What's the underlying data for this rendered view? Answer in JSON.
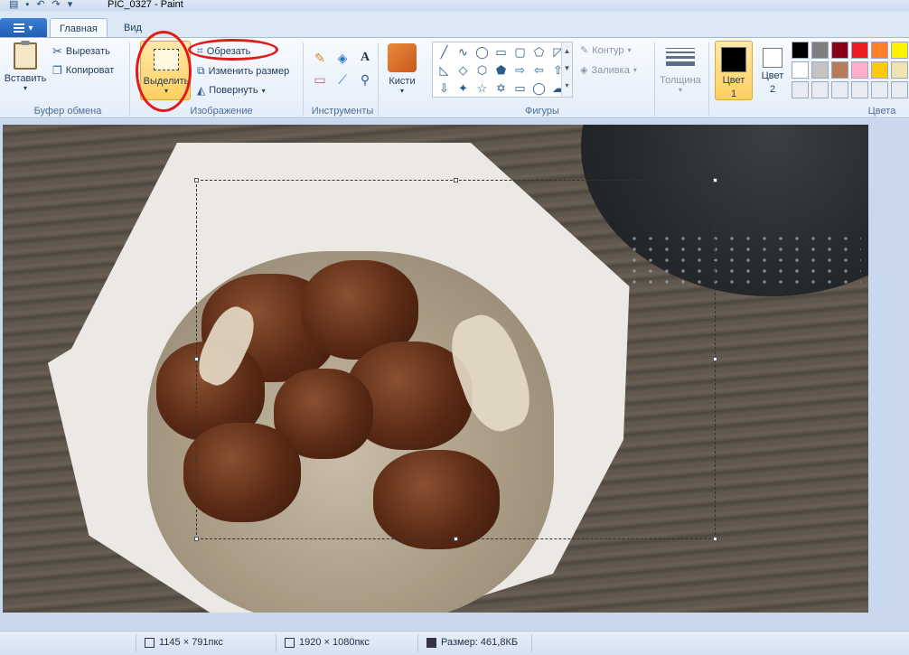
{
  "window": {
    "title": "PIC_0327 - Paint"
  },
  "quick_access": [
    "save-icon",
    "undo-icon",
    "redo-icon",
    "dropdown-icon"
  ],
  "tabs": [
    {
      "label": "Главная",
      "active": true
    },
    {
      "label": "Вид",
      "active": false
    }
  ],
  "clipboard": {
    "paste": "Вставить",
    "cut": "Вырезать",
    "copy": "Копироват",
    "group": "Буфер обмена"
  },
  "image": {
    "select": "Выделить",
    "crop": "Обрезать",
    "resize": "Изменить размер",
    "rotate": "Повернуть",
    "group": "Изображение"
  },
  "tools": {
    "group": "Инструменты",
    "items": [
      "pencil-icon",
      "fill-icon",
      "text-icon",
      "eraser-icon",
      "color-picker-icon",
      "magnifier-icon"
    ]
  },
  "brushes": {
    "label": "Кисти"
  },
  "shapes": {
    "group": "Фигуры",
    "outline": "Контур",
    "fill": "Заливка",
    "glyphs": [
      "╱",
      "∿",
      "◯",
      "▭",
      "▢",
      "⬠",
      "◸",
      "◺",
      "◇",
      "⬡",
      "⬟",
      "⇨",
      "⇦",
      "⇧",
      "⇩",
      "✦",
      "☆",
      "✡",
      "▭",
      "◯",
      "☁"
    ]
  },
  "thickness": {
    "label": "Толщина"
  },
  "colors": {
    "group": "Цвета",
    "color1": {
      "label_line1": "Цвет",
      "label_line2": "1",
      "value": "#000000"
    },
    "color2": {
      "label_line1": "Цвет",
      "label_line2": "2",
      "value": "#ffffff"
    },
    "palette": [
      "#000000",
      "#7f7f7f",
      "#880015",
      "#ed1c24",
      "#ff7f27",
      "#fff200",
      "#ffffff",
      "#c3c3c3",
      "#b97a57",
      "#ffaec9",
      "#ffc90e",
      "#efe4b0",
      "#e8ecf2",
      "#e8ecf2",
      "#e8ecf2",
      "#e8ecf2",
      "#e8ecf2",
      "#e8ecf2"
    ]
  },
  "status": {
    "selection_size": "1145 × 791пкс",
    "image_size": "1920 × 1080пкс",
    "file_size": "Размер: 461,8КБ"
  }
}
